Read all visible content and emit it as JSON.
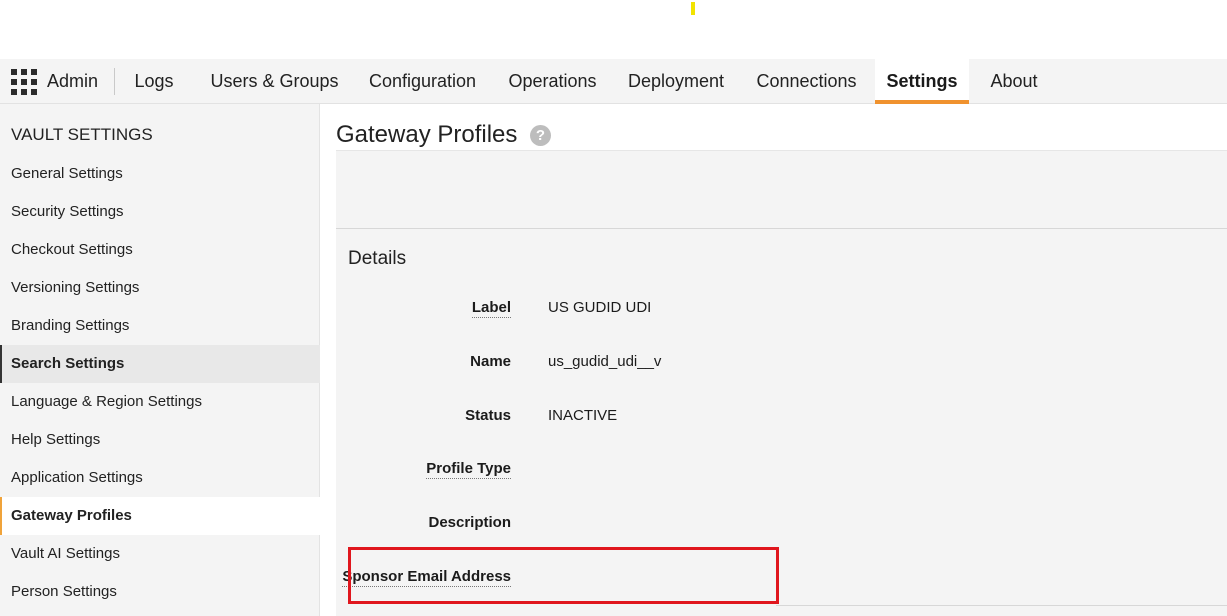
{
  "top_nav": {
    "admin_label": "Admin",
    "tabs": [
      {
        "label": "Logs",
        "active": false
      },
      {
        "label": "Users & Groups",
        "active": false
      },
      {
        "label": "Configuration",
        "active": false
      },
      {
        "label": "Operations",
        "active": false
      },
      {
        "label": "Deployment",
        "active": false
      },
      {
        "label": "Connections",
        "active": false
      },
      {
        "label": "Settings",
        "active": true
      },
      {
        "label": "About",
        "active": false
      }
    ],
    "active_accent_color": "#f0922e"
  },
  "sidebar": {
    "heading": "VAULT SETTINGS",
    "items": [
      {
        "label": "General Settings"
      },
      {
        "label": "Security Settings"
      },
      {
        "label": "Checkout Settings"
      },
      {
        "label": "Versioning Settings"
      },
      {
        "label": "Branding Settings"
      },
      {
        "label": "Search Settings",
        "state": "hover"
      },
      {
        "label": "Language & Region Settings"
      },
      {
        "label": "Help Settings"
      },
      {
        "label": "Application Settings"
      },
      {
        "label": "Gateway Profiles",
        "state": "selected"
      },
      {
        "label": "Vault AI Settings"
      },
      {
        "label": "Person Settings"
      }
    ]
  },
  "main": {
    "title": "Gateway Profiles",
    "help_icon": "question-circle-icon",
    "section_title": "Details",
    "fields": [
      {
        "label": "Label",
        "value": "US GUDID UDI"
      },
      {
        "label": "Name",
        "value": "us_gudid_udi__v"
      },
      {
        "label": "Status",
        "value": "INACTIVE"
      },
      {
        "label": "Profile Type",
        "value": ""
      },
      {
        "label": "Description",
        "value": ""
      },
      {
        "label": "Sponsor Email Address",
        "value": ""
      }
    ]
  },
  "highlight_color": "#e0161d"
}
